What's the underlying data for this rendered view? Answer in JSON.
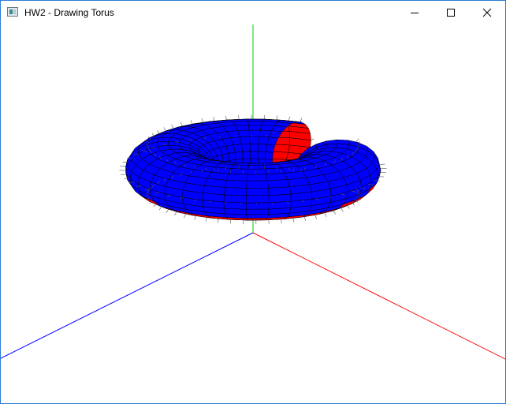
{
  "window": {
    "title": "HW2 - Drawing Torus",
    "icon": "window-app-icon",
    "controls": {
      "minimize_icon": "minimize-icon",
      "maximize_icon": "maximize-icon",
      "close_icon": "close-icon"
    }
  },
  "scene": {
    "object": "torus",
    "background": "#ffffff",
    "colors": {
      "axis_x": "#ff0000",
      "axis_y": "#00cc00",
      "axis_z": "#0000ff",
      "outer_surface": "#0000ff",
      "inner_surface": "#ff0000",
      "mesh_lines": "#000000",
      "normals": "#555555"
    }
  }
}
